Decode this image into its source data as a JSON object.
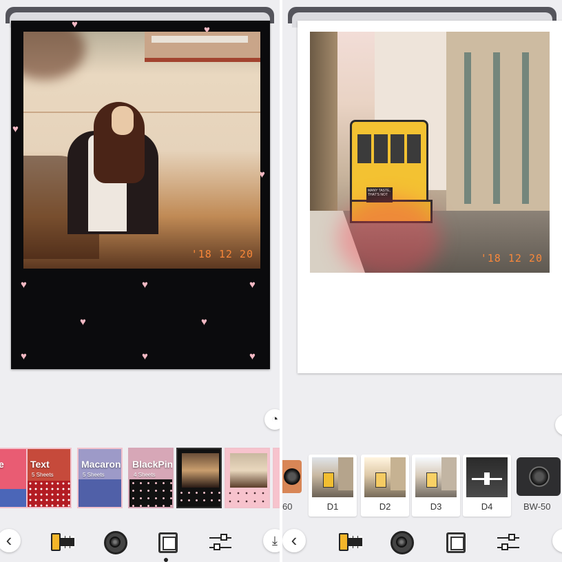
{
  "left_screen": {
    "photo": {
      "date_stamp": "'18 12 20"
    },
    "stickers": [
      {
        "label": "e",
        "sub": ""
      },
      {
        "label": "Text",
        "sub": "5 Sheets"
      },
      {
        "label": "Macaron",
        "sub": "5 Sheets"
      },
      {
        "label": "BlackPink",
        "sub": "4 Sheets"
      },
      {
        "label": "",
        "sub": ""
      },
      {
        "label": "",
        "sub": ""
      }
    ],
    "toolbar": {
      "back_icon": "‹",
      "download_icon": "⤓",
      "timer_icon": "◔"
    }
  },
  "right_screen": {
    "photo": {
      "date_stamp": "'18 12 20",
      "tram_sign": "MANY TASTE, THAT'S NOT"
    },
    "side_label": "60",
    "filters": [
      {
        "name": "D1"
      },
      {
        "name": "D2"
      },
      {
        "name": "D3"
      },
      {
        "name": "D4"
      }
    ],
    "camera_label": "BW-50",
    "toolbar": {
      "back_icon": "‹"
    }
  },
  "colors": {
    "background": "#eeeef1",
    "heart": "#f3b8c3",
    "date_stamp": "#ff8a3a",
    "film_yellow": "#f4b62a"
  }
}
